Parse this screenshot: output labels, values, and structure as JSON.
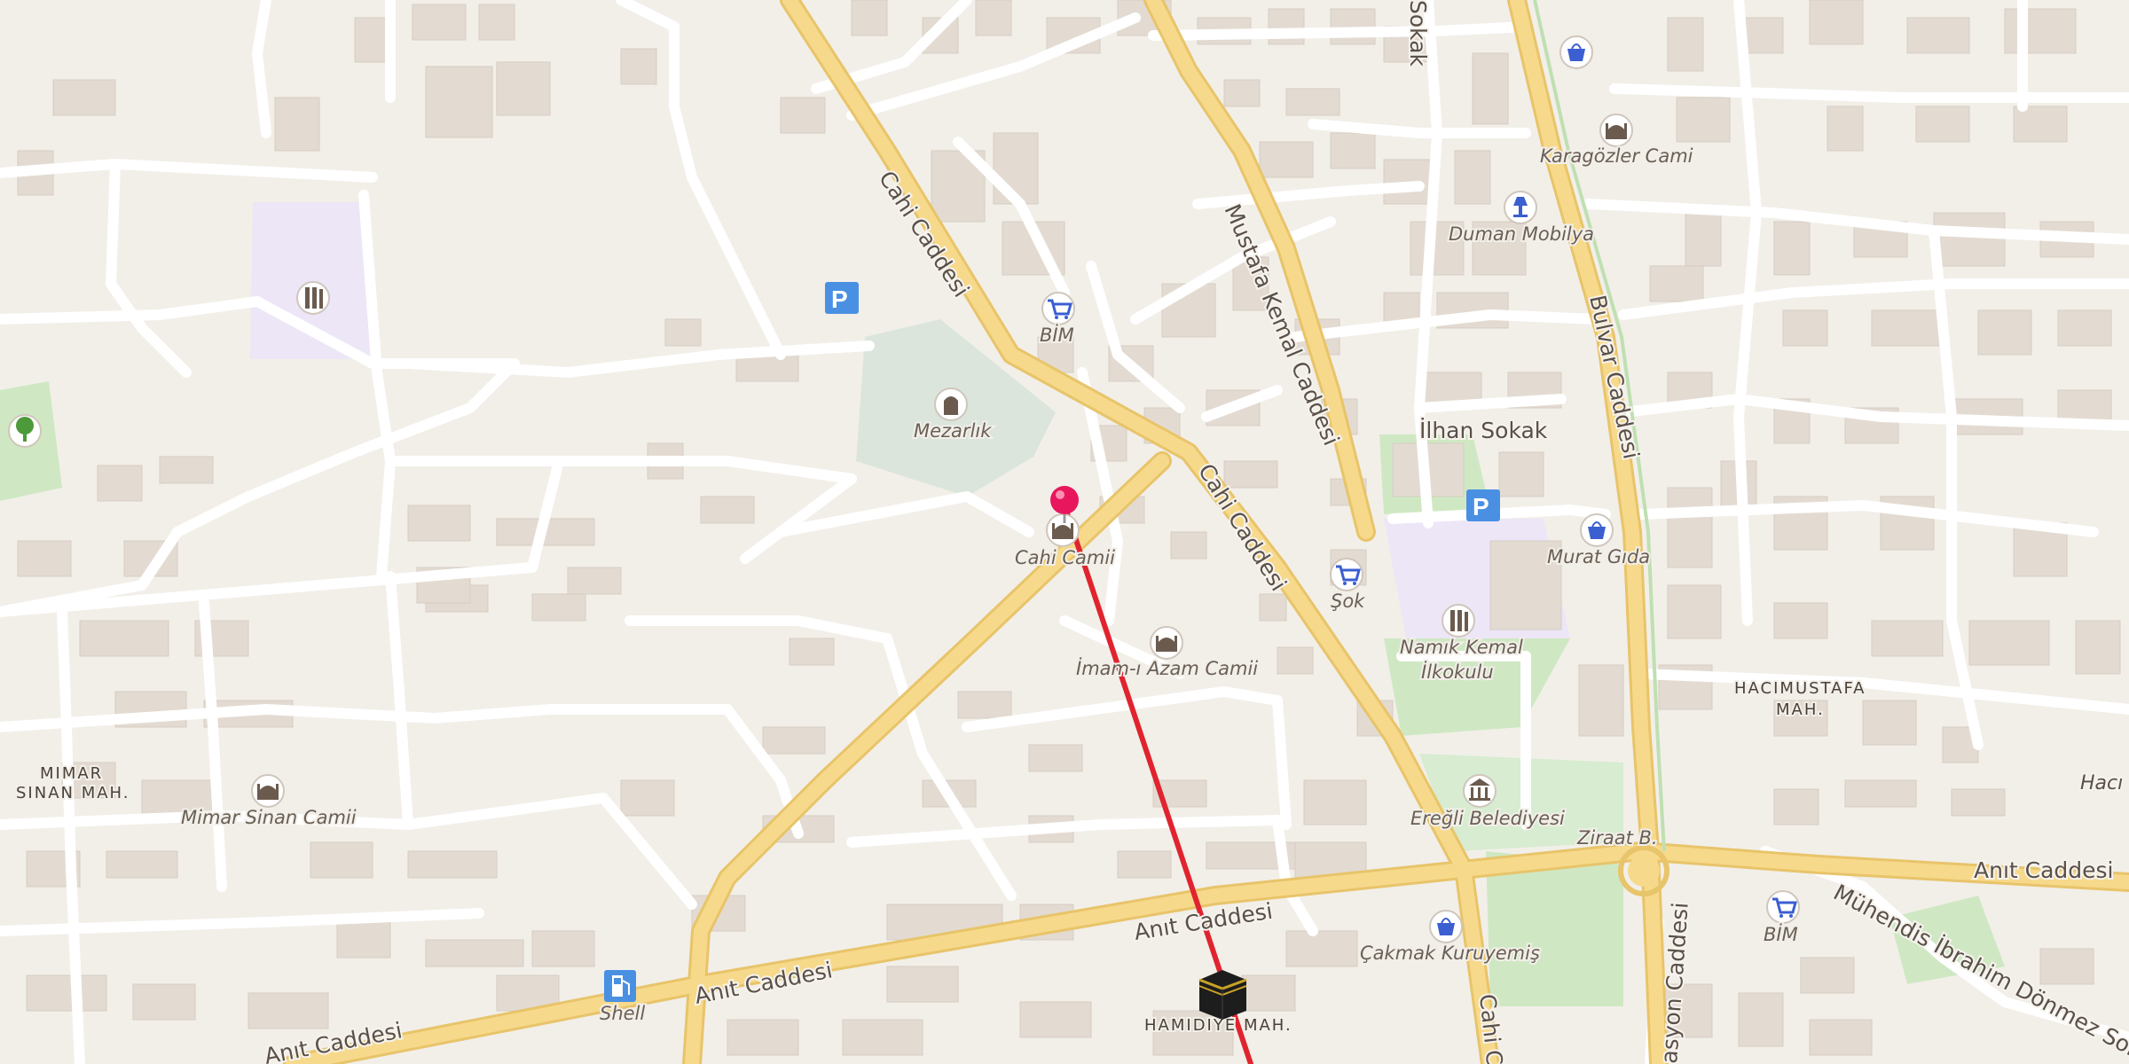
{
  "map": {
    "streets": [
      {
        "id": "cahi-1",
        "name": "Cahi Caddesi"
      },
      {
        "id": "cahi-2",
        "name": "Cahi Caddesi"
      },
      {
        "id": "mustafa",
        "name": "Mustafa Kemal Caddesi"
      },
      {
        "id": "bulvar",
        "name": "Bulvar Caddesi"
      },
      {
        "id": "ilhan",
        "name": "İlhan Sokak"
      },
      {
        "id": "anit-1",
        "name": "Anıt Caddesi"
      },
      {
        "id": "anit-2",
        "name": "Anıt Caddesi"
      },
      {
        "id": "anit-3",
        "name": "Anıt Caddesi"
      },
      {
        "id": "anit-4",
        "name": "Anıt Caddesi"
      },
      {
        "id": "sokak",
        "name": "Sokak"
      },
      {
        "id": "muhendis",
        "name": "Mühendis İbrahim Dönmez Sok"
      },
      {
        "id": "cahi-3",
        "name": "Cahi C"
      },
      {
        "id": "asyon",
        "name": "asyon Caddesi"
      }
    ],
    "pois": [
      {
        "id": "bim-1",
        "name": "BİM",
        "icon": "shopping-cart-icon"
      },
      {
        "id": "mezarlik",
        "name": "Mezarlık",
        "icon": "cemetery-icon"
      },
      {
        "id": "cahi-camii",
        "name": "Cahi Camii",
        "icon": "mosque-icon"
      },
      {
        "id": "imam-azam",
        "name": "İmam-ı Azam Camii",
        "icon": "mosque-icon"
      },
      {
        "id": "mimar-sinan",
        "name": "Mimar Sinan Camii",
        "icon": "mosque-icon"
      },
      {
        "id": "karagozler",
        "name": "Karagözler Cami",
        "icon": "mosque-icon"
      },
      {
        "id": "duman",
        "name": "Duman Mobilya",
        "icon": "lamp-icon"
      },
      {
        "id": "murat",
        "name": "Murat Gıda",
        "icon": "shopping-bag-icon"
      },
      {
        "id": "sok",
        "name": "Şok",
        "icon": "shopping-cart-icon"
      },
      {
        "id": "namik",
        "name": "Namık Kemal İlkokulu",
        "icon": "school-icon"
      },
      {
        "id": "eregli",
        "name": "Ereğli Belediyesi",
        "icon": "town-hall-icon"
      },
      {
        "id": "ziraat",
        "name": "Ziraat B.",
        "icon": "bank-icon"
      },
      {
        "id": "cakmak",
        "name": "Çakmak Kuruyemiş",
        "icon": "shopping-bag-icon"
      },
      {
        "id": "bim-2",
        "name": "BİM",
        "icon": "shopping-cart-icon"
      },
      {
        "id": "shell",
        "name": "Shell",
        "icon": "fuel-station-icon"
      }
    ],
    "areas": [
      {
        "id": "hacimustafa",
        "line1": "HACIMUSTAFA",
        "line2": "MAH."
      },
      {
        "id": "mimar-sinan-mah",
        "line1": "MIMAR",
        "line2": "SINAN MAH."
      },
      {
        "id": "hamidiye",
        "line1": "HAMIDIYE MAH.",
        "line2": ""
      },
      {
        "id": "haci",
        "line1": "Hacı",
        "line2": ""
      }
    ],
    "route": {
      "color": "#e0242f"
    },
    "pin": {
      "color": "#e8175d"
    },
    "colors": {
      "background": "#f2efe9",
      "building": "#e3dbd2",
      "major_road": "#f7d98b",
      "major_road_casing": "#e8c46a",
      "minor_road": "#ffffff",
      "park": "#cfe8c3",
      "school_area": "#ece6f7",
      "cemetery": "#dbe5dc",
      "poi_icon": "#6b5b4e",
      "shop_icon": "#3b5fd0",
      "parking": "#4a90e2"
    }
  }
}
